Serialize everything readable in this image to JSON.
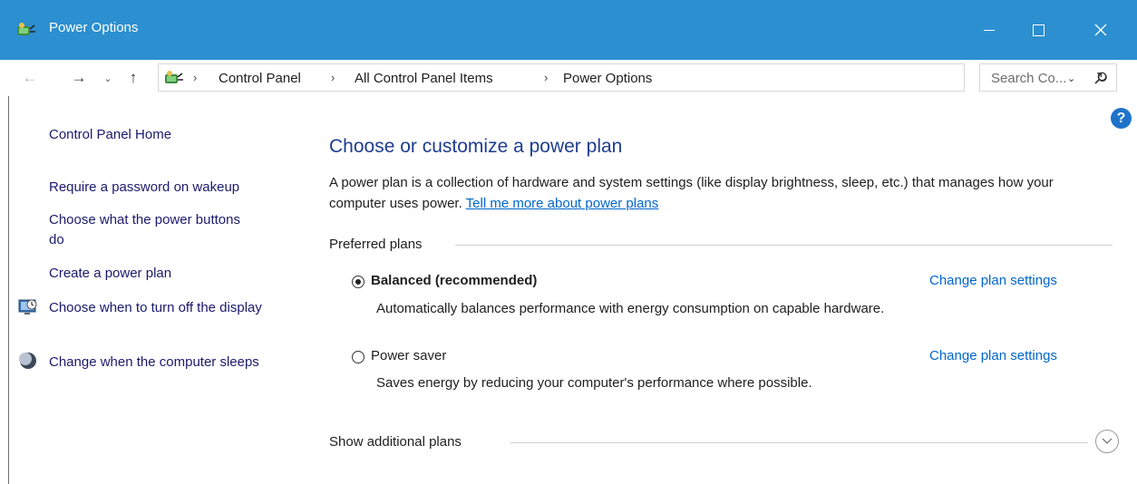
{
  "window": {
    "title": "Power Options"
  },
  "nav": {
    "back_icon": "arrow-left-icon",
    "forward_icon": "arrow-right-icon",
    "recent_icon": "chevron-down-icon",
    "up_icon": "arrow-up-icon"
  },
  "breadcrumb": [
    {
      "label": "Control Panel"
    },
    {
      "label": "All Control Panel Items"
    },
    {
      "label": "Power Options"
    }
  ],
  "search": {
    "placeholder": "Search Co..."
  },
  "sidebar": {
    "items": [
      {
        "label": "Control Panel Home"
      },
      {
        "label": "Require a password on wakeup"
      },
      {
        "label": "Choose what the power buttons do"
      },
      {
        "label": "Create a power plan"
      },
      {
        "label": "Choose when to turn off the display",
        "icon": "monitor-clock-icon"
      },
      {
        "label": "Change when the computer sleeps",
        "icon": "moon-icon"
      }
    ]
  },
  "main": {
    "title": "Choose or customize a power plan",
    "description": "A power plan is a collection of hardware and system settings (like display brightness, sleep, etc.) that manages how your computer uses power.",
    "learn_more_link": "Tell me more about power plans",
    "preferred_label": "Preferred plans",
    "plans": [
      {
        "name": "Balanced (recommended)",
        "selected": true,
        "description": "Automatically balances performance with energy consumption on capable hardware.",
        "link": "Change plan settings"
      },
      {
        "name": "Power saver",
        "selected": false,
        "description": "Saves energy by reducing your computer's performance where possible.",
        "link": "Change plan settings"
      }
    ],
    "additional_label": "Show additional plans"
  },
  "colors": {
    "titlebar": "#2b8fd0",
    "link": "#0066cc",
    "heading": "#1e3d8f",
    "side_link": "#1a1a6e"
  }
}
